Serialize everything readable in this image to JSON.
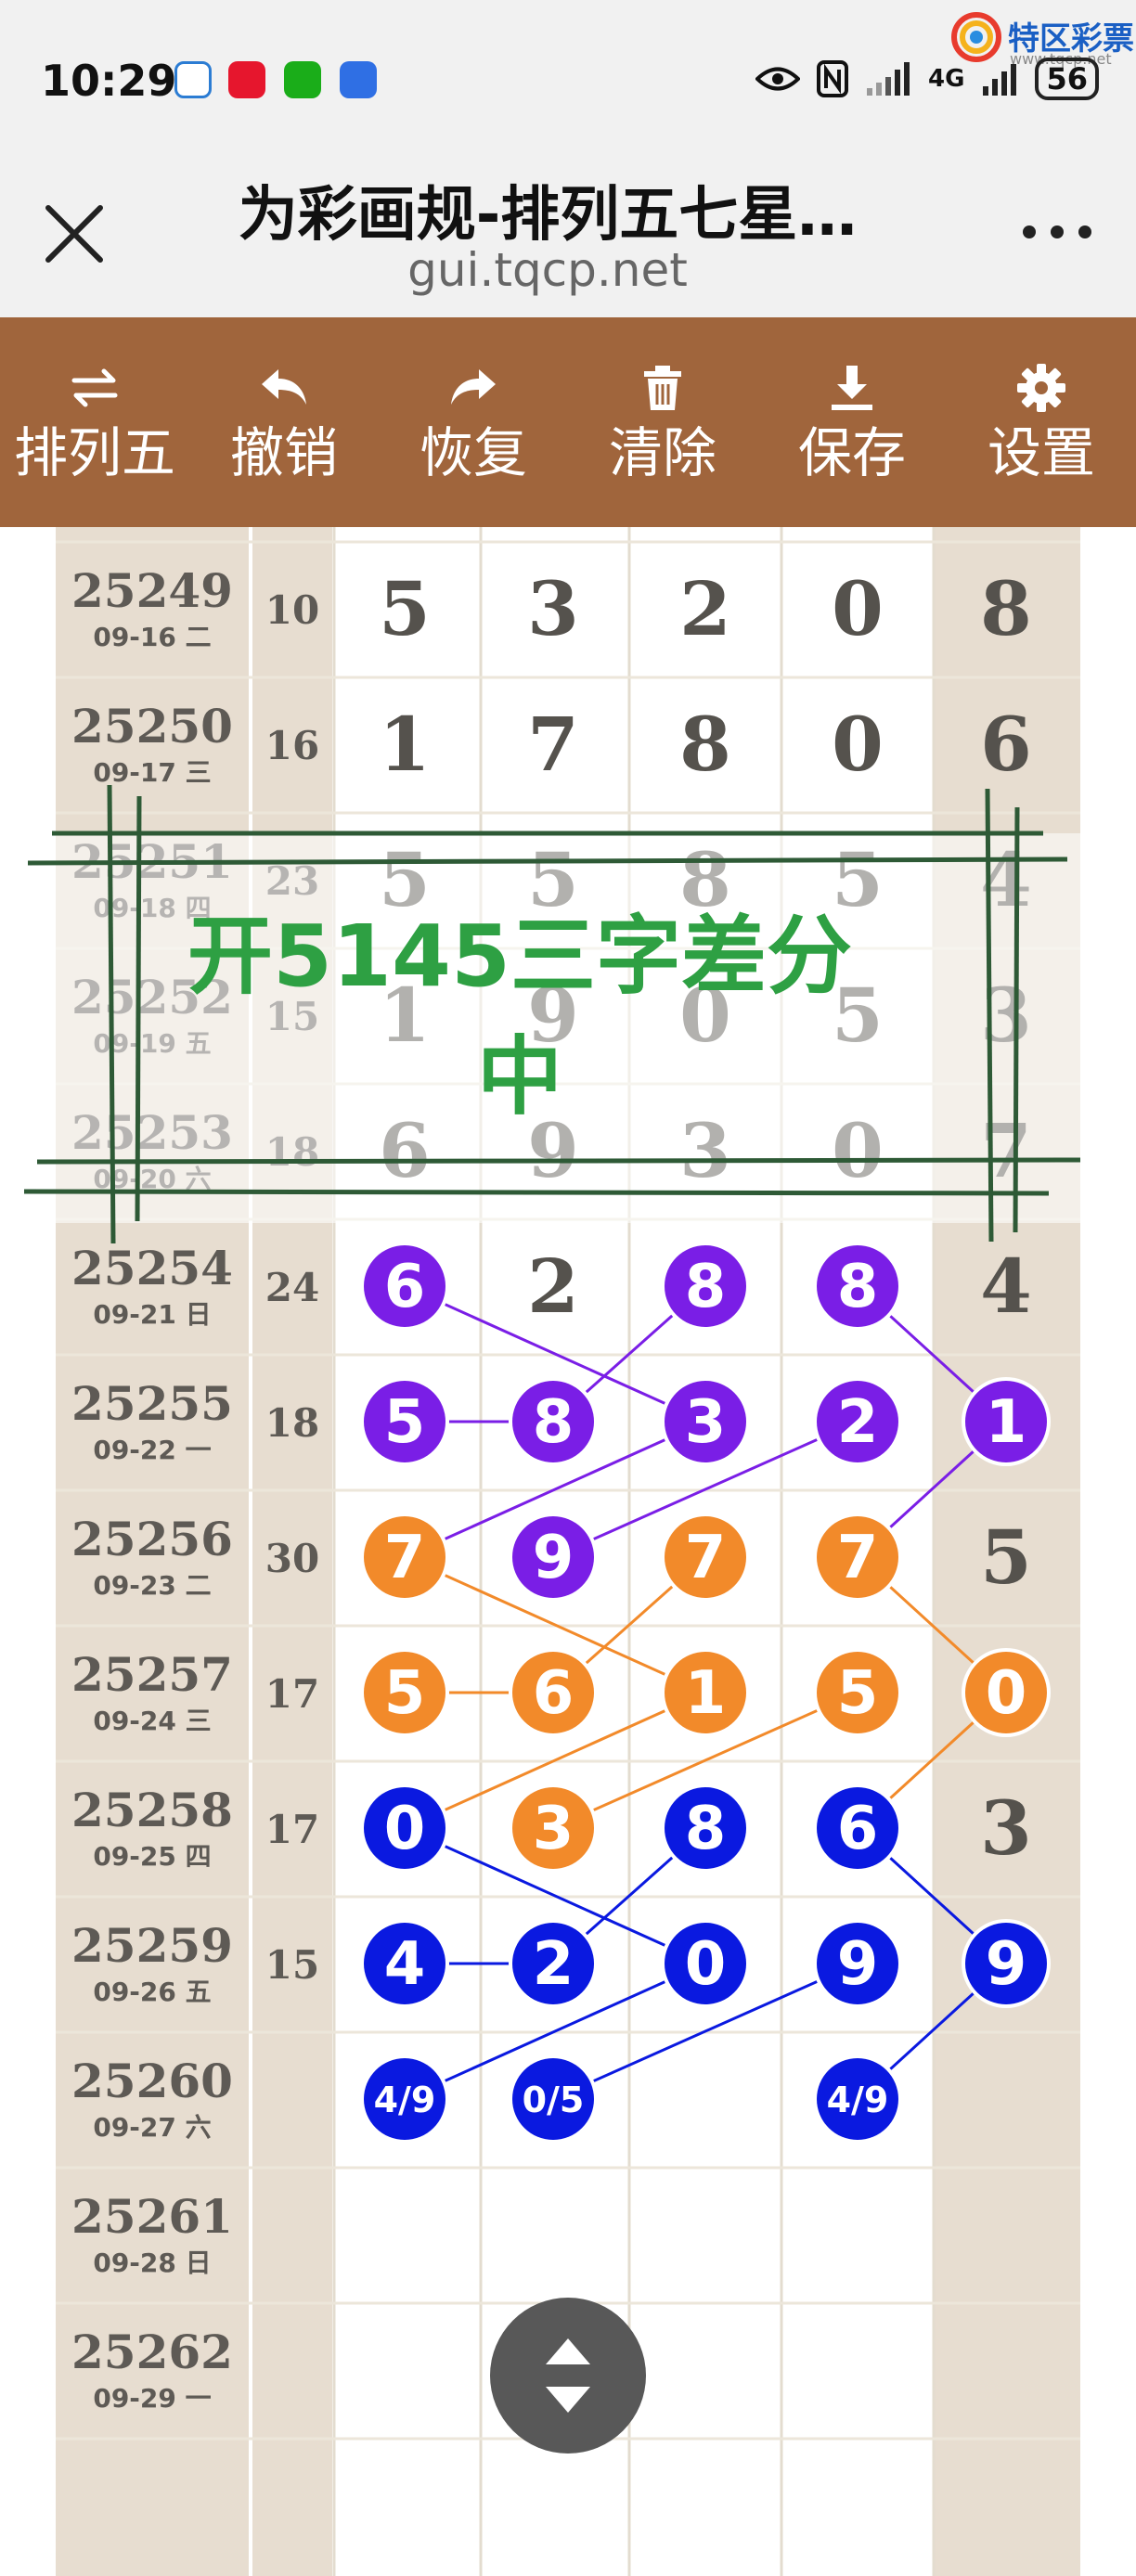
{
  "status_bar": {
    "time": "10:29",
    "network": "4G",
    "battery": "56",
    "watermark_text": "特区彩票网",
    "watermark_url": "www.tqcp.net"
  },
  "nav": {
    "title": "为彩画规-排列五七星…",
    "url": "gui.tqcp.net"
  },
  "toolbar": {
    "items": [
      {
        "label": "排列五",
        "icon": "swap-icon"
      },
      {
        "label": "撤销",
        "icon": "undo-icon"
      },
      {
        "label": "恢复",
        "icon": "redo-icon"
      },
      {
        "label": "清除",
        "icon": "trash-icon"
      },
      {
        "label": "保存",
        "icon": "download-icon"
      },
      {
        "label": "设置",
        "icon": "gear-icon"
      }
    ]
  },
  "annotation": {
    "line1": "开5145三字差分",
    "line2": "中",
    "color": "#2ea043"
  },
  "colors": {
    "purple": "#7a1ee6",
    "orange": "#f28a2a",
    "blue": "#0a19e0",
    "toolbar": "#a0653c",
    "side_column": "#e7ddd0"
  },
  "rows": [
    {
      "period": "25249",
      "date": "09-16 二",
      "sum": "10",
      "digits": [
        "5",
        "3",
        "2",
        "0",
        "8"
      ],
      "balls": []
    },
    {
      "period": "25250",
      "date": "09-17 三",
      "sum": "16",
      "digits": [
        "1",
        "7",
        "8",
        "0",
        "6"
      ],
      "balls": []
    },
    {
      "period": "25251",
      "date": "09-18 四",
      "sum": "23",
      "digits": [
        "5",
        "5",
        "8",
        "5",
        "4"
      ],
      "balls": []
    },
    {
      "period": "25252",
      "date": "09-19 五",
      "sum": "15",
      "digits": [
        "1",
        "9",
        "0",
        "5",
        "3"
      ],
      "balls": []
    },
    {
      "period": "25253",
      "date": "09-20 六",
      "sum": "18",
      "digits": [
        "6",
        "9",
        "3",
        "0",
        "7"
      ],
      "balls": []
    },
    {
      "period": "25254",
      "date": "09-21 日",
      "sum": "24",
      "digits": [
        "6",
        "2",
        "8",
        "8",
        "4"
      ],
      "balls": [
        {
          "col": 0,
          "value": "6",
          "color": "purple"
        },
        {
          "col": 2,
          "value": "8",
          "color": "purple"
        },
        {
          "col": 3,
          "value": "8",
          "color": "purple"
        }
      ]
    },
    {
      "period": "25255",
      "date": "09-22 一",
      "sum": "18",
      "digits": [
        "5",
        "8",
        "3",
        "2",
        "1"
      ],
      "balls": [
        {
          "col": 0,
          "value": "5",
          "color": "purple"
        },
        {
          "col": 1,
          "value": "8",
          "color": "purple"
        },
        {
          "col": 2,
          "value": "3",
          "color": "purple"
        },
        {
          "col": 3,
          "value": "2",
          "color": "purple"
        },
        {
          "col": 4,
          "value": "1",
          "color": "purple"
        }
      ]
    },
    {
      "period": "25256",
      "date": "09-23 二",
      "sum": "30",
      "digits": [
        "7",
        "9",
        "7",
        "7",
        "5"
      ],
      "balls": [
        {
          "col": 0,
          "value": "7",
          "color": "orange"
        },
        {
          "col": 1,
          "value": "9",
          "color": "purple"
        },
        {
          "col": 2,
          "value": "7",
          "color": "orange"
        },
        {
          "col": 3,
          "value": "7",
          "color": "orange"
        }
      ]
    },
    {
      "period": "25257",
      "date": "09-24 三",
      "sum": "17",
      "digits": [
        "5",
        "6",
        "1",
        "5",
        "0"
      ],
      "balls": [
        {
          "col": 0,
          "value": "5",
          "color": "orange"
        },
        {
          "col": 1,
          "value": "6",
          "color": "orange"
        },
        {
          "col": 2,
          "value": "1",
          "color": "orange"
        },
        {
          "col": 3,
          "value": "5",
          "color": "orange"
        },
        {
          "col": 4,
          "value": "0",
          "color": "orange"
        }
      ]
    },
    {
      "period": "25258",
      "date": "09-25 四",
      "sum": "17",
      "digits": [
        "0",
        "3",
        "8",
        "6",
        "3"
      ],
      "balls": [
        {
          "col": 0,
          "value": "0",
          "color": "blue"
        },
        {
          "col": 1,
          "value": "3",
          "color": "orange"
        },
        {
          "col": 2,
          "value": "8",
          "color": "blue"
        },
        {
          "col": 3,
          "value": "6",
          "color": "blue"
        }
      ]
    },
    {
      "period": "25259",
      "date": "09-26 五",
      "sum": "15",
      "digits": [
        "4",
        "2",
        "0",
        "9",
        "9"
      ],
      "balls": [
        {
          "col": 0,
          "value": "4",
          "color": "blue"
        },
        {
          "col": 1,
          "value": "2",
          "color": "blue"
        },
        {
          "col": 2,
          "value": "0",
          "color": "blue"
        },
        {
          "col": 3,
          "value": "9",
          "color": "blue"
        },
        {
          "col": 4,
          "value": "9",
          "color": "blue"
        }
      ]
    },
    {
      "period": "25260",
      "date": "09-27 六",
      "sum": "",
      "digits": [
        "",
        "",
        "",
        "",
        ""
      ],
      "balls": [
        {
          "col": 0,
          "value": "4/9",
          "color": "blue",
          "small": true
        },
        {
          "col": 1,
          "value": "0/5",
          "color": "blue",
          "small": true
        },
        {
          "col": 3,
          "value": "4/9",
          "color": "blue",
          "small": true
        }
      ]
    },
    {
      "period": "25261",
      "date": "09-28 日",
      "sum": "",
      "digits": [
        "",
        "",
        "",
        "",
        ""
      ],
      "balls": []
    },
    {
      "period": "25262",
      "date": "09-29 一",
      "sum": "",
      "digits": [
        "",
        "",
        "",
        "",
        ""
      ],
      "balls": []
    }
  ],
  "connections": [
    {
      "from": [
        5,
        0
      ],
      "to": [
        6,
        2
      ],
      "color": "purple"
    },
    {
      "from": [
        5,
        2
      ],
      "to": [
        6,
        1
      ],
      "color": "purple"
    },
    {
      "from": [
        5,
        3
      ],
      "to": [
        6,
        4
      ],
      "color": "purple"
    },
    {
      "from": [
        6,
        0
      ],
      "to": [
        6,
        1
      ],
      "color": "purple"
    },
    {
      "from": [
        6,
        2
      ],
      "to": [
        7,
        0
      ],
      "color": "purple"
    },
    {
      "from": [
        6,
        3
      ],
      "to": [
        7,
        1
      ],
      "color": "purple"
    },
    {
      "from": [
        6,
        4
      ],
      "to": [
        7,
        3
      ],
      "color": "purple"
    },
    {
      "from": [
        7,
        0
      ],
      "to": [
        8,
        2
      ],
      "color": "orange"
    },
    {
      "from": [
        7,
        2
      ],
      "to": [
        8,
        1
      ],
      "color": "orange"
    },
    {
      "from": [
        7,
        3
      ],
      "to": [
        8,
        4
      ],
      "color": "orange"
    },
    {
      "from": [
        8,
        0
      ],
      "to": [
        8,
        1
      ],
      "color": "orange"
    },
    {
      "from": [
        8,
        2
      ],
      "to": [
        9,
        0
      ],
      "color": "orange"
    },
    {
      "from": [
        8,
        3
      ],
      "to": [
        9,
        1
      ],
      "color": "orange"
    },
    {
      "from": [
        8,
        4
      ],
      "to": [
        9,
        3
      ],
      "color": "orange"
    },
    {
      "from": [
        9,
        0
      ],
      "to": [
        10,
        2
      ],
      "color": "blue"
    },
    {
      "from": [
        9,
        2
      ],
      "to": [
        10,
        1
      ],
      "color": "blue"
    },
    {
      "from": [
        9,
        3
      ],
      "to": [
        10,
        4
      ],
      "color": "blue"
    },
    {
      "from": [
        10,
        0
      ],
      "to": [
        10,
        1
      ],
      "color": "blue"
    },
    {
      "from": [
        10,
        2
      ],
      "to": [
        11,
        0
      ],
      "color": "blue"
    },
    {
      "from": [
        10,
        3
      ],
      "to": [
        11,
        1
      ],
      "color": "blue"
    },
    {
      "from": [
        10,
        4
      ],
      "to": [
        11,
        3
      ],
      "color": "blue"
    }
  ]
}
